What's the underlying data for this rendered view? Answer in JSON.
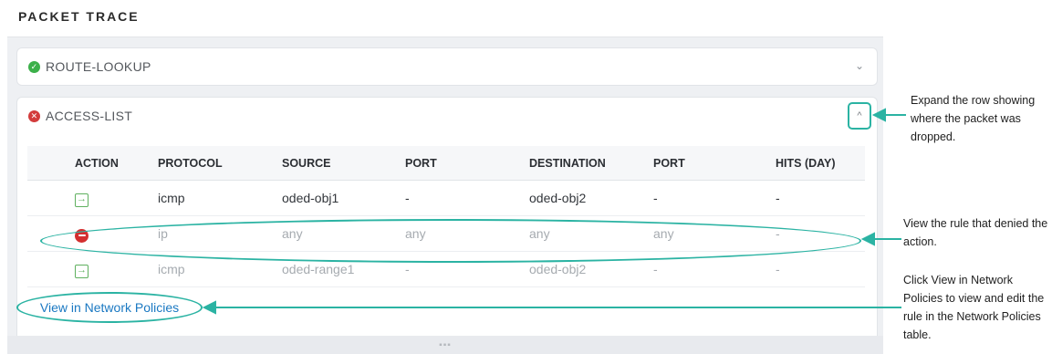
{
  "page_title": "PACKET TRACE",
  "rows": [
    {
      "status": "ok",
      "label": "ROUTE-LOOKUP",
      "status_color": "#3cb04a"
    },
    {
      "status": "error",
      "label": "ACCESS-LIST",
      "status_color": "#d33c3c"
    }
  ],
  "table": {
    "headers": [
      "ACTION",
      "PROTOCOL",
      "SOURCE",
      "PORT",
      "DESTINATION",
      "PORT",
      "HITS (DAY)"
    ],
    "rows": [
      {
        "action": "permit-icon",
        "protocol": "icmp",
        "source": "oded-obj1",
        "port": "-",
        "destination": "oded-obj2",
        "port2": "-",
        "hits": "-"
      },
      {
        "action": "deny-icon",
        "protocol": "ip",
        "source": "any",
        "port": "any",
        "destination": "any",
        "port2": "any",
        "hits": "-"
      },
      {
        "action": "permit-icon",
        "protocol": "icmp",
        "source": "oded-range1",
        "port": "-",
        "destination": "oded-obj2",
        "port2": "-",
        "hits": "-"
      }
    ]
  },
  "link": {
    "label": "View in Network Policies"
  },
  "callouts": {
    "expand": "Expand the row showing where the packet was dropped.",
    "rule": "View the rule that denied the action.",
    "view": "Click View in Network Policies to view and edit the rule in the Network Policies table."
  },
  "colors": {
    "accent": "#2bb3a3",
    "link": "#1a78c2"
  }
}
